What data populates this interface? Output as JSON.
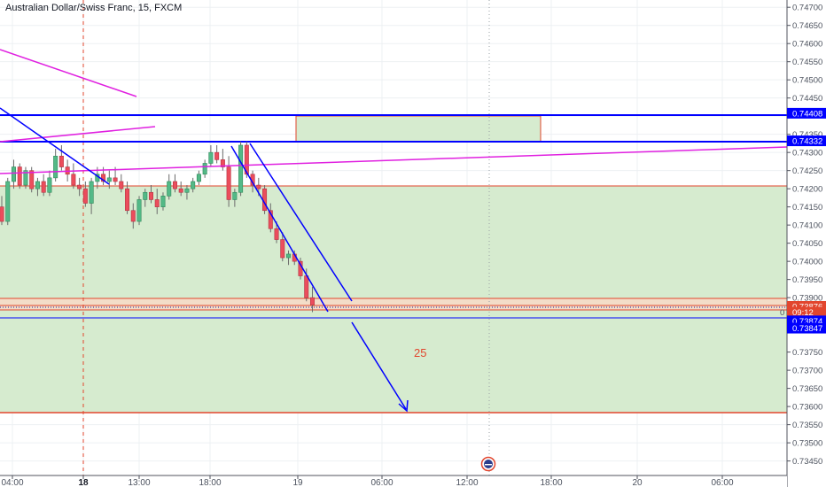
{
  "header": {
    "symbol_title": "Australian Dollar/Swiss Franc, 15, FXCM"
  },
  "price_axis": {
    "ticks": [
      "0.74700",
      "0.74650",
      "0.74600",
      "0.74550",
      "0.74500",
      "0.74450",
      "0.74350",
      "0.74300",
      "0.74250",
      "0.74200",
      "0.74150",
      "0.74100",
      "0.74050",
      "0.74000",
      "0.73950",
      "0.73900",
      "0.73750",
      "0.73700",
      "0.73650",
      "0.73600",
      "0.73550",
      "0.73500",
      "0.73450"
    ],
    "labels": [
      {
        "text": "0.74408",
        "bg": "#0000ff",
        "fg": "#ffffff",
        "price": 0.74408
      },
      {
        "text": "0.74332",
        "bg": "#0000ff",
        "fg": "#ffffff",
        "price": 0.74332
      },
      {
        "text": "0.73876",
        "bg": "#e2462e",
        "fg": "#ffffff",
        "price": 0.73876
      },
      {
        "text": "09:12",
        "bg": "#e2462e",
        "fg": "#ffffff",
        "price": 0.7386
      },
      {
        "text": "0.73874",
        "bg": "#0000ff",
        "fg": "#ffffff",
        "price": 0.73836
      },
      {
        "text": "0.73847",
        "bg": "#0000ff",
        "fg": "#ffffff",
        "price": 0.73816
      }
    ],
    "partial_label": "0"
  },
  "time_axis": {
    "ticks": [
      {
        "label": "04:00",
        "bold": false
      },
      {
        "label": "18",
        "bold": true
      },
      {
        "label": "13:00",
        "bold": false
      },
      {
        "label": "18:00",
        "bold": false
      },
      {
        "label": "19",
        "bold": false
      },
      {
        "label": "06:00",
        "bold": false
      },
      {
        "label": "12:00",
        "bold": false
      },
      {
        "label": "18:00",
        "bold": false
      },
      {
        "label": "20",
        "bold": false
      },
      {
        "label": "06:00",
        "bold": false
      }
    ]
  },
  "annotation_text": "25",
  "colors": {
    "up": "#53b987",
    "down": "#eb4d5c",
    "wick": "#6b6b6b",
    "zone_fill": "#d6ebcf",
    "zone_border": "#e2462e",
    "blue_line": "#0000ff",
    "magenta_line": "#e020e0"
  },
  "chart_data": {
    "type": "candlestick",
    "title": "Australian Dollar/Swiss Franc, 15, FXCM",
    "ylim": [
      0.7341,
      0.7472
    ],
    "x_index_range": [
      0,
      140
    ],
    "timeframe": "15",
    "source": "FXCM",
    "candles": [
      [
        0.7415,
        0.7418,
        0.741,
        0.7411
      ],
      [
        0.7411,
        0.7423,
        0.741,
        0.7422
      ],
      [
        0.7422,
        0.7428,
        0.742,
        0.7426
      ],
      [
        0.7426,
        0.7427,
        0.742,
        0.7421
      ],
      [
        0.7421,
        0.7426,
        0.742,
        0.7425
      ],
      [
        0.7425,
        0.7426,
        0.7419,
        0.742
      ],
      [
        0.742,
        0.7423,
        0.7418,
        0.7422
      ],
      [
        0.7422,
        0.7424,
        0.7418,
        0.7419
      ],
      [
        0.7419,
        0.7425,
        0.7418,
        0.7423
      ],
      [
        0.7423,
        0.7431,
        0.7422,
        0.7429
      ],
      [
        0.7429,
        0.7432,
        0.7425,
        0.7426
      ],
      [
        0.7426,
        0.7428,
        0.7422,
        0.7424
      ],
      [
        0.7424,
        0.7427,
        0.742,
        0.7421
      ],
      [
        0.7421,
        0.7423,
        0.7418,
        0.742
      ],
      [
        0.742,
        0.7422,
        0.7415,
        0.7416
      ],
      [
        0.7416,
        0.7423,
        0.7413,
        0.7422
      ],
      [
        0.7422,
        0.7426,
        0.742,
        0.7424
      ],
      [
        0.7424,
        0.7426,
        0.7421,
        0.7422
      ],
      [
        0.7422,
        0.7425,
        0.742,
        0.7423
      ],
      [
        0.7423,
        0.7426,
        0.7421,
        0.7422
      ],
      [
        0.7422,
        0.7424,
        0.7419,
        0.742
      ],
      [
        0.742,
        0.7422,
        0.7413,
        0.7414
      ],
      [
        0.7414,
        0.7416,
        0.7409,
        0.7411
      ],
      [
        0.7411,
        0.7418,
        0.741,
        0.7417
      ],
      [
        0.7417,
        0.742,
        0.7415,
        0.7419
      ],
      [
        0.7419,
        0.7421,
        0.7416,
        0.7417
      ],
      [
        0.7417,
        0.742,
        0.7413,
        0.7415
      ],
      [
        0.7415,
        0.7419,
        0.7414,
        0.7418
      ],
      [
        0.7418,
        0.7424,
        0.7417,
        0.7422
      ],
      [
        0.7422,
        0.7424,
        0.7419,
        0.742
      ],
      [
        0.742,
        0.7422,
        0.7418,
        0.7419
      ],
      [
        0.7419,
        0.7421,
        0.7417,
        0.742
      ],
      [
        0.742,
        0.7423,
        0.7419,
        0.7422
      ],
      [
        0.7422,
        0.7425,
        0.7421,
        0.7424
      ],
      [
        0.7424,
        0.7428,
        0.7423,
        0.7427
      ],
      [
        0.7427,
        0.7432,
        0.7426,
        0.743
      ],
      [
        0.743,
        0.7432,
        0.7427,
        0.7428
      ],
      [
        0.7428,
        0.7431,
        0.7425,
        0.7426
      ],
      [
        0.7426,
        0.7429,
        0.7415,
        0.7417
      ],
      [
        0.7417,
        0.742,
        0.7415,
        0.7419
      ],
      [
        0.7419,
        0.7433,
        0.7418,
        0.7432
      ],
      [
        0.7432,
        0.7433,
        0.7423,
        0.7424
      ],
      [
        0.7424,
        0.7425,
        0.7419,
        0.7421
      ],
      [
        0.7421,
        0.7423,
        0.7418,
        0.742
      ],
      [
        0.742,
        0.7421,
        0.7413,
        0.7414
      ],
      [
        0.7414,
        0.7416,
        0.7408,
        0.7409
      ],
      [
        0.7409,
        0.7411,
        0.7405,
        0.7406
      ],
      [
        0.7406,
        0.7408,
        0.74,
        0.7401
      ],
      [
        0.7401,
        0.7403,
        0.7399,
        0.7402
      ],
      [
        0.7402,
        0.7403,
        0.7399,
        0.74
      ],
      [
        0.74,
        0.7401,
        0.7395,
        0.7396
      ],
      [
        0.7396,
        0.7398,
        0.7389,
        0.739
      ],
      [
        0.739,
        0.7393,
        0.7386,
        0.7388
      ]
    ]
  }
}
